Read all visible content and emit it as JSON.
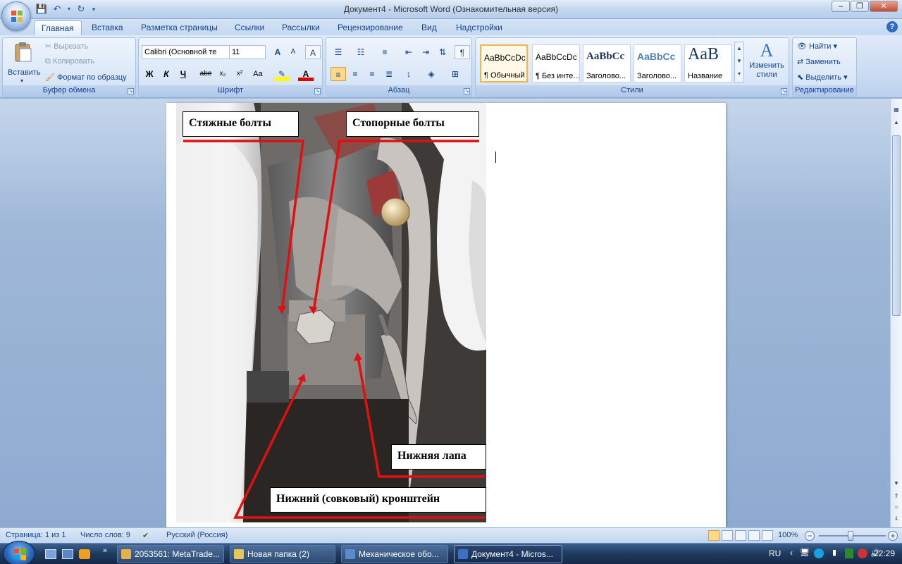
{
  "window": {
    "title": "Документ4 - Microsoft Word (Ознакомительная версия)"
  },
  "tabs": [
    "Главная",
    "Вставка",
    "Разметка страницы",
    "Ссылки",
    "Рассылки",
    "Рецензирование",
    "Вид",
    "Надстройки"
  ],
  "clipboard": {
    "paste": "Вставить",
    "cut": "Вырезать",
    "copy": "Копировать",
    "format_painter": "Формат по образцу",
    "label": "Буфер обмена"
  },
  "font": {
    "family": "Calibri (Основной те",
    "size": "11",
    "label": "Шрифт",
    "bold": "Ж",
    "italic": "К",
    "underline": "Ч",
    "strike": "abe",
    "subscript": "x₂",
    "superscript": "x²",
    "case": "Aa",
    "grow": "A",
    "shrink": "A",
    "clear": "A"
  },
  "paragraph": {
    "label": "Абзац",
    "pilcrow": "¶"
  },
  "styles": {
    "label": "Стили",
    "items": [
      {
        "sample": "AaBbCcDc",
        "name": "¶ Обычный"
      },
      {
        "sample": "AaBbCcDc",
        "name": "¶ Без инте..."
      },
      {
        "sample": "AaBbCc",
        "name": "Заголово..."
      },
      {
        "sample": "AaBbCc",
        "name": "Заголово..."
      },
      {
        "sample": "AaB",
        "name": "Название"
      }
    ],
    "change": "Изменить стили",
    "change_arrow": "▾"
  },
  "editing": {
    "label": "Редактирование",
    "find": "Найти",
    "replace": "Заменить",
    "select": "Выделить"
  },
  "document": {
    "callouts": {
      "tie_bolts": "Стяжные болты",
      "stop_bolts": "Стопорные болты",
      "lower_paw": "Нижняя лапа",
      "lower_bracket": "Нижний (совковый) кронштейн"
    }
  },
  "status": {
    "page": "Страница: 1 из 1",
    "words": "Число слов: 9",
    "language": "Русский (Россия)",
    "zoom": "100%",
    "zoom_out": "−",
    "zoom_in": "+"
  },
  "taskbar": {
    "items": [
      {
        "label": "2053561: MetaTrade...",
        "color": "#e8b04a"
      },
      {
        "label": "Новая папка (2)",
        "color": "#e8c65a"
      },
      {
        "label": "Механическое обо...",
        "color": "#5a8ad0"
      },
      {
        "label": "Документ4 - Micros...",
        "color": "#3d6fc4"
      }
    ],
    "lang": "RU",
    "clock": "22:29"
  },
  "colors": {
    "accent": "#15428b",
    "callout_line": "#e01010"
  }
}
